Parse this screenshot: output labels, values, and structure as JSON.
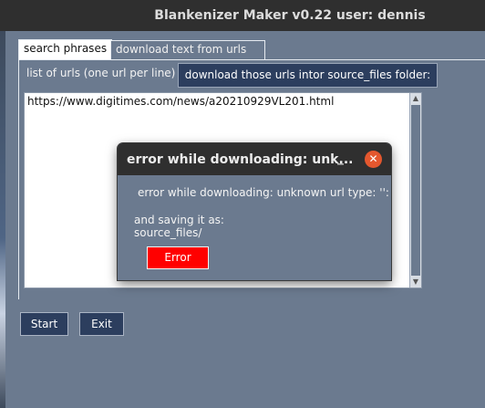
{
  "window": {
    "title": "Blankenizer Maker v0.22 user: dennis"
  },
  "tabs": [
    {
      "label": "search phrases"
    },
    {
      "label": "download text from urls"
    }
  ],
  "urls": {
    "label": "list of urls (one url per line)",
    "download_button": "download those urls intor source_files folder:",
    "content": "https://www.digitimes.com/news/a20210929VL201.html"
  },
  "footer": {
    "start": "Start",
    "exit": "Exit"
  },
  "dialog": {
    "title": "error while downloading: unk...",
    "minimize_glyph": "_",
    "close_glyph": "✕",
    "message": "error while downloading: unknown url type: '':",
    "saving_line1": "and saving it as:",
    "saving_line2": "source_files/",
    "button": "Error",
    "accent": "#ff0000"
  }
}
